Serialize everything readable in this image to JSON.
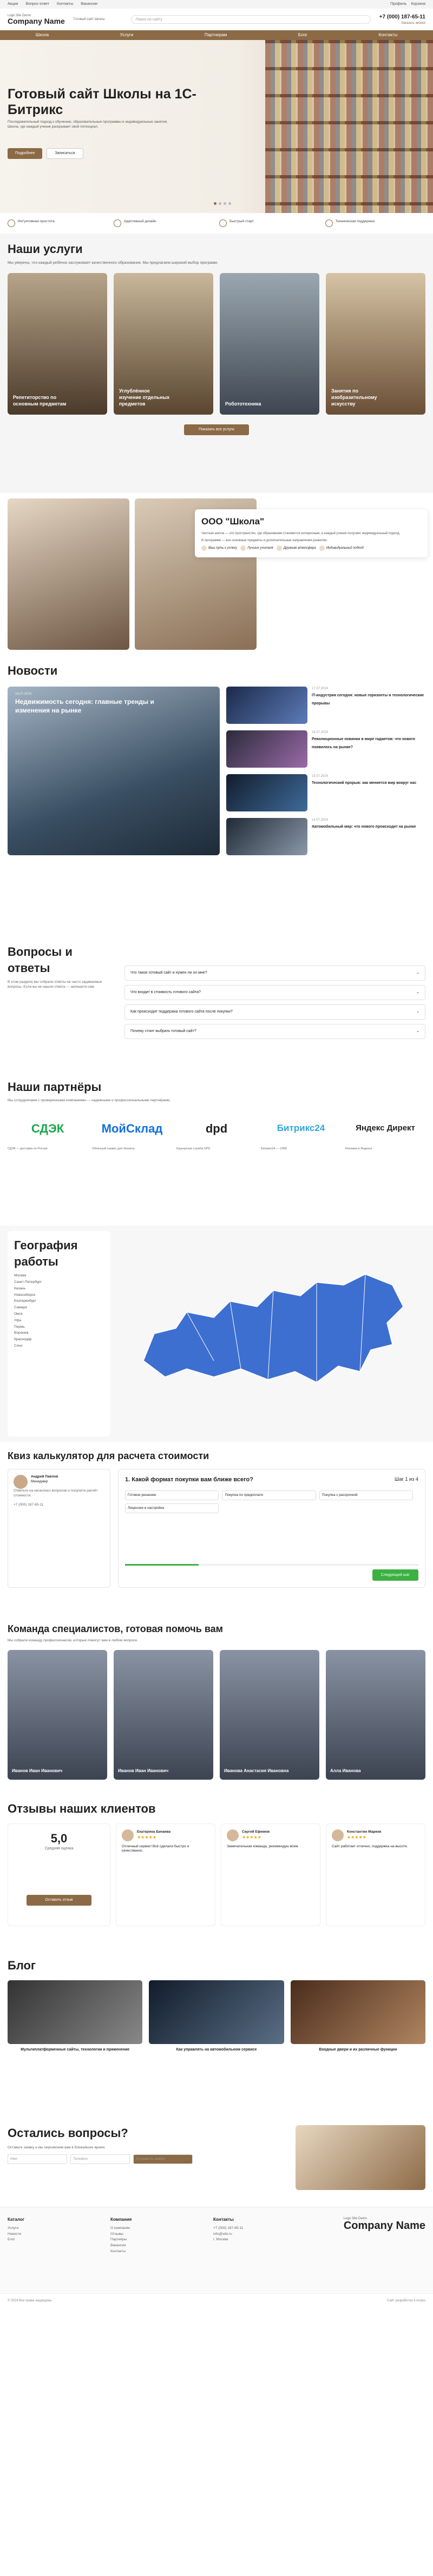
{
  "topbar": {
    "items": [
      "Акции",
      "Вопрос-ответ",
      "Контакты",
      "Вакансии"
    ],
    "right": [
      "Профиль",
      "Корзина"
    ]
  },
  "header": {
    "logo_small": "Logo Site Demo",
    "logo_big": "Company Name",
    "tagline": "Готовый сайт Школы",
    "search_placeholder": "Поиск по сайту",
    "phone": "+7 (000) 187-65-11",
    "phone_sub": "Заказать звонок"
  },
  "nav": [
    "Школа",
    "Услуги",
    "Партнерам",
    "Блог",
    "Контакты"
  ],
  "hero": {
    "title": "Готовый сайт Школы на 1С-Битрикс",
    "text": "Последовательный подход к обучению, образовательные программы и индивидуальные занятия. Школа, где каждый ученик раскрывает свой потенциал.",
    "btn1": "Подробнее",
    "btn2": "Записаться"
  },
  "advantages": [
    "Интуитивная простота",
    "Адаптивный дизайн",
    "Быстрый старт",
    "Техническая поддержка"
  ],
  "services": {
    "title": "Наши услуги",
    "intro": "Мы уверены, что каждый ребёнок заслуживает качественного образования. Мы предлагаем широкий выбор программ.",
    "cards": [
      "Репетиторство по основным предметам",
      "Углублённое изучение отдельных предметов",
      "Робототехника",
      "Занятия по изобразительному искусству"
    ],
    "button": "Показать все услуги"
  },
  "about": {
    "title": "ООО \"Школа\"",
    "p1": "Частная школа — это пространство, где образование становится интересным, а каждый ученик получает индивидуальный подход.",
    "p2": "В программе — все основные предметы и дополнительные направления развития.",
    "tags": [
      "Ваш путь к успеху",
      "Лучшие учителя",
      "Дружная атмосфера",
      "Индивидуальный подход"
    ]
  },
  "news": {
    "title": "Новости",
    "big": {
      "date": "18.07.2024",
      "title": "Недвижимость сегодня: главные тренды и изменения на рынке"
    },
    "items": [
      {
        "date": "17.07.2024",
        "title": "IT-индустрия сегодня: новые горизонты и технологические прорывы"
      },
      {
        "date": "16.07.2024",
        "title": "Революционные новинки в мире гаджетов: что нового появилось на рынке?"
      },
      {
        "date": "15.07.2024",
        "title": "Технологический прорыв: как меняется мир вокруг нас"
      },
      {
        "date": "14.07.2024",
        "title": "Автомобильный мир: что нового происходит на рынке"
      }
    ]
  },
  "faq": {
    "title": "Вопросы и ответы",
    "text": "В этом разделе мы собрали ответы на часто задаваемые вопросы. Если вы не нашли ответа — напишите нам.",
    "questions": [
      "Что такое готовый сайт и нужен ли он мне?",
      "Что входит в стоимость готового сайта?",
      "Как происходит поддержка готового сайта после покупки?",
      "Почему стоит выбрать готовый сайт?"
    ]
  },
  "partners": {
    "title": "Наши партнёры",
    "text": "Мы сотрудничаем с проверенными компаниями — надежными и профессиональными партнёрами.",
    "list": [
      {
        "name": "СДЭК",
        "desc": "СДЭК — доставка по России"
      },
      {
        "name": "МойСклад",
        "desc": "Облачный сервис для бизнеса"
      },
      {
        "name": "dpd",
        "desc": "Курьерская служба DPD"
      },
      {
        "name": "Битрикс24",
        "desc": "Битрикс24 — CRM"
      },
      {
        "name": "Яндекс Директ",
        "desc": "Реклама в Яндексе"
      }
    ]
  },
  "geo": {
    "title": "География работы",
    "cities": [
      "Москва",
      "Санкт-Петербург",
      "Казань",
      "Новосибирск",
      "Екатеринбург",
      "Самара",
      "Омск",
      "Уфа",
      "Пермь",
      "Воронеж",
      "Краснодар",
      "Сочи"
    ]
  },
  "quiz": {
    "title": "Квиз калькулятор для расчета стоимости",
    "manager": "Андрей Павлов",
    "manager_role": "Менеджер",
    "manager_text": "Ответьте на несколько вопросов и получите расчёт стоимости.",
    "phone": "+7 (000) 187-65-11",
    "question": "1. Какой формат покупки вам ближе всего?",
    "step": "Шаг 1 из 4",
    "options": [
      "Готовое решение",
      "Покупка по предоплате",
      "Покупка с рассрочкой",
      "Лицензия и настройка"
    ],
    "progress": 25,
    "next": "Следующий шаг"
  },
  "team": {
    "title": "Команда специалистов, готовая помочь вам",
    "text": "Мы собрали команду профессионалов, которые помогут вам в любом вопросе.",
    "members": [
      "Иванов Иван Иванович",
      "Иванов Иван Иванович",
      "Иванова Анастасия Ивановна",
      "Алла Иванова"
    ]
  },
  "reviews": {
    "title": "Отзывы наших клиентов",
    "rating": "5,0",
    "rating_text": "Средняя оценка",
    "cards": [
      {
        "name": "Екатерина Бачаева",
        "stars": "★★★★★",
        "text": "Отличный сервис! Всё сделали быстро и качественно."
      },
      {
        "name": "Сергей Ефимов",
        "stars": "★★★★★",
        "text": "Замечательная команда, рекомендую всем."
      },
      {
        "name": "Константин Марков",
        "stars": "★★★★★",
        "text": "Сайт работает отлично, поддержка на высоте."
      }
    ],
    "button": "Оставить отзыв"
  },
  "blog": {
    "title": "Блог",
    "items": [
      "Мультиплатформенные сайты, технологии и применение",
      "Как управлять на автомобильном сервисе",
      "Входные двери и их различные функции"
    ]
  },
  "contact": {
    "title": "Остались вопросы?",
    "text": "Оставьте заявку и мы перезвоним вам в ближайшее время.",
    "name_ph": "Имя",
    "phone_ph": "Телефон",
    "button": "Отправить заявку"
  },
  "footer": {
    "cols": [
      {
        "title": "Каталог",
        "items": [
          "Услуги",
          "Новости",
          "Блог"
        ]
      },
      {
        "title": "Компания",
        "items": [
          "О компании",
          "Отзывы",
          "Партнёры",
          "Вакансии",
          "Контакты"
        ]
      },
      {
        "title": "Контакты",
        "items": [
          "+7 (000) 187-65-11",
          "info@site.ru",
          "г. Москва"
        ]
      }
    ],
    "logo_small": "Logo Site Demo",
    "logo_big": "Company Name",
    "copyright": "© 2024 Все права защищены",
    "dev": "Сайт разработан в Аспро"
  }
}
